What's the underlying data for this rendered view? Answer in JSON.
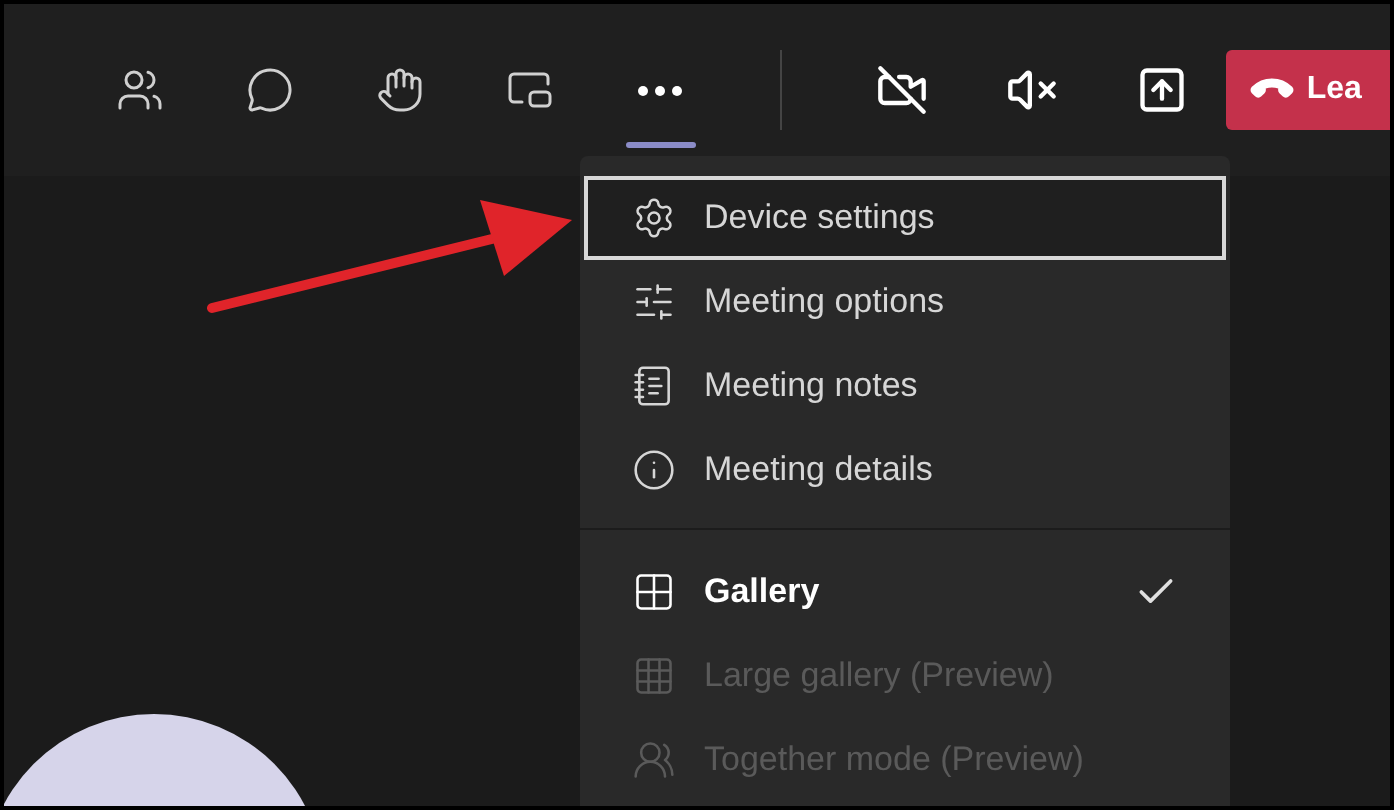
{
  "toolbar": {
    "buttons": [
      {
        "kind": "people",
        "selected": false
      },
      {
        "kind": "chat",
        "selected": false
      },
      {
        "kind": "reactions",
        "selected": false
      },
      {
        "kind": "rooms",
        "selected": false
      },
      {
        "kind": "more",
        "selected": true
      }
    ],
    "devices": [
      {
        "kind": "camera"
      },
      {
        "kind": "speaker"
      },
      {
        "kind": "share"
      }
    ],
    "leave_button": {
      "label": "Lea"
    }
  },
  "menu": {
    "sections": [
      {
        "items": [
          {
            "kind": "settings",
            "label": "Device settings",
            "focused": true
          },
          {
            "kind": "options",
            "label": "Meeting options",
            "focused": false
          },
          {
            "kind": "notes",
            "label": "Meeting notes",
            "focused": false
          },
          {
            "kind": "details",
            "label": "Meeting details",
            "focused": false
          }
        ]
      },
      {
        "items": [
          {
            "kind": "gallery",
            "label": "Gallery",
            "checked": true,
            "disabled": false
          },
          {
            "kind": "large",
            "label": "Large gallery (Preview)",
            "checked": false,
            "disabled": true
          },
          {
            "kind": "together",
            "label": "Together mode (Preview)",
            "checked": false,
            "disabled": true
          }
        ]
      }
    ]
  }
}
